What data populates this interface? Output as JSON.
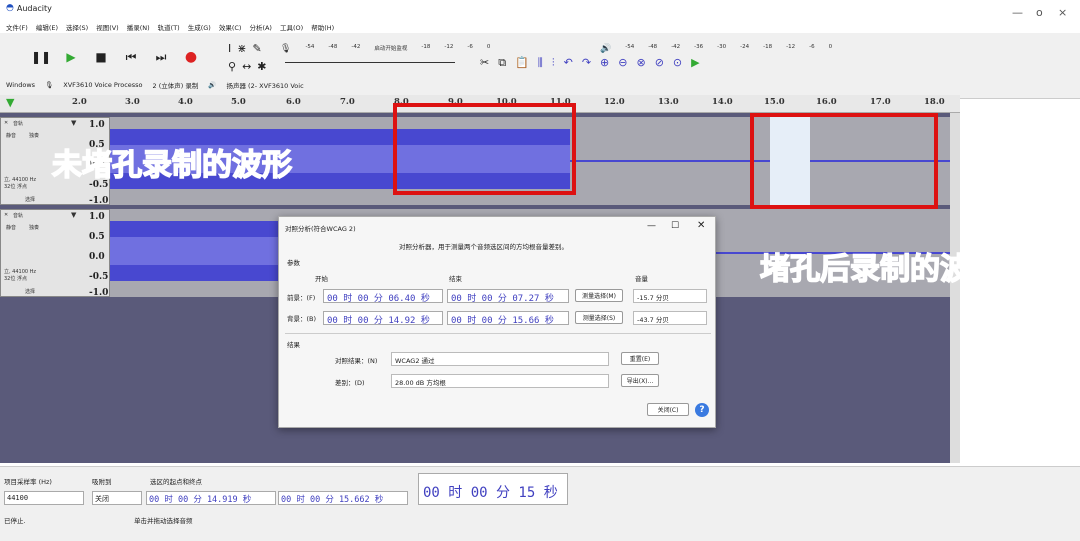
{
  "window": {
    "title": "Audacity",
    "minimize": "—",
    "maximize": "o",
    "close": "×"
  },
  "menu": [
    "文件(F)",
    "编辑(E)",
    "选择(S)",
    "视图(V)",
    "播录(N)",
    "轨道(T)",
    "生成(G)",
    "效果(C)",
    "分析(A)",
    "工具(O)",
    "帮助(H)"
  ],
  "meter": {
    "ticks": [
      "-54",
      "-48",
      "-42",
      "启动开始监视",
      "-18",
      "-12",
      "-6",
      "0"
    ],
    "ticks2": [
      "-54",
      "-48",
      "-42",
      "-36",
      "-30",
      "-24",
      "-18",
      "-12",
      "-6",
      "0"
    ]
  },
  "devices": {
    "host": "Windows",
    "input": "XVF3610 Voice Processo",
    "channels": "2 (立体声) 录制",
    "output": "扬声器 (2- XVF3610 Voic"
  },
  "ruler": [
    "2.0",
    "3.0",
    "4.0",
    "5.0",
    "6.0",
    "7.0",
    "8.0",
    "9.0",
    "10.0",
    "11.0",
    "12.0",
    "13.0",
    "14.0",
    "15.0",
    "16.0",
    "17.0",
    "18.0"
  ],
  "tracks": [
    {
      "name": "音轨",
      "mute": "静音",
      "solo": "独奏",
      "rate": "立, 44100 Hz",
      "fmt": "32位 浮点",
      "select": "选择",
      "scale": [
        "1.0",
        "0.5",
        "0.0",
        "-0.5",
        "-1.0"
      ]
    },
    {
      "name": "音轨",
      "mute": "静音",
      "solo": "独奏",
      "rate": "立, 44100 Hz",
      "fmt": "32位 浮点",
      "select": "选择",
      "scale": [
        "1.0",
        "0.5",
        "0.0",
        "-0.5",
        "-1.0"
      ]
    }
  ],
  "annotations": {
    "before": "未堵孔录制的波形",
    "after": "堵孔后录制的波形"
  },
  "dialog": {
    "title": "对照分析(符合WCAG 2)",
    "description": "对照分析器，用于测量两个音频选区间的方均根音量差别。",
    "params_label": "参数",
    "col_start": "开始",
    "col_end": "结束",
    "col_volume": "音量",
    "fg_label": "前景：(F)",
    "fg_start": "00 时 00 分 06.40 秒",
    "fg_end": "00 时 00 分 07.27 秒",
    "fg_measure": "测量选择(M)",
    "fg_volume": "-15.7 分贝",
    "bg_label": "背景：(B)",
    "bg_start": "00 时 00 分 14.92 秒",
    "bg_end": "00 时 00 分 15.66 秒",
    "bg_measure": "测量选择(S)",
    "bg_volume": "-43.7 分贝",
    "results_label": "结果",
    "result_label": "对照结果：(N)",
    "result_value": "WCAG2 通过",
    "reset": "重置(E)",
    "diff_label": "差别：(D)",
    "diff_value": "28.00 dB 方均根",
    "export": "导出(X)...",
    "close": "关闭(C)",
    "help": "?"
  },
  "bottom": {
    "rate_label": "项目采样率 (Hz)",
    "snap_label": "吸附到",
    "sel_label": "选区的起点和终点",
    "rate_value": "44100",
    "snap_value": "关闭",
    "sel_start": "00 时 00 分 14.919 秒",
    "sel_end": "00 时 00 分 15.662 秒",
    "position": "00 时 00 分 15 秒",
    "status": "已停止.",
    "hint": "单击并拖动选择音频"
  }
}
